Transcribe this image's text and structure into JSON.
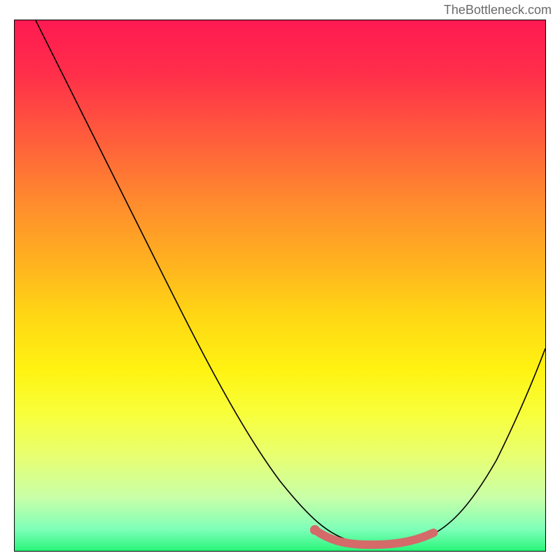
{
  "attribution": "TheBottleneck.com",
  "chart_data": {
    "type": "line",
    "title": "",
    "xlabel": "",
    "ylabel": "",
    "xlim": [
      0,
      100
    ],
    "ylim": [
      0,
      100
    ],
    "series": [
      {
        "name": "bottleneck-curve",
        "x": [
          4,
          10,
          20,
          30,
          40,
          48,
          55,
          60,
          65,
          70,
          75,
          80,
          85,
          90,
          95,
          100
        ],
        "y": [
          100,
          89,
          74,
          59,
          44,
          31,
          18,
          9,
          3,
          2,
          2,
          4,
          9,
          18,
          28,
          38
        ]
      },
      {
        "name": "optimal-range-highlight",
        "x": [
          58,
          62,
          66,
          70,
          74,
          78,
          80
        ],
        "y": [
          5,
          3,
          2,
          2,
          2,
          3,
          5
        ]
      }
    ],
    "background": {
      "type": "vertical-gradient",
      "stops": [
        {
          "pos": 0,
          "color": "#ff1a52"
        },
        {
          "pos": 50,
          "color": "#ffd814"
        },
        {
          "pos": 100,
          "color": "#29f57a"
        }
      ]
    }
  }
}
